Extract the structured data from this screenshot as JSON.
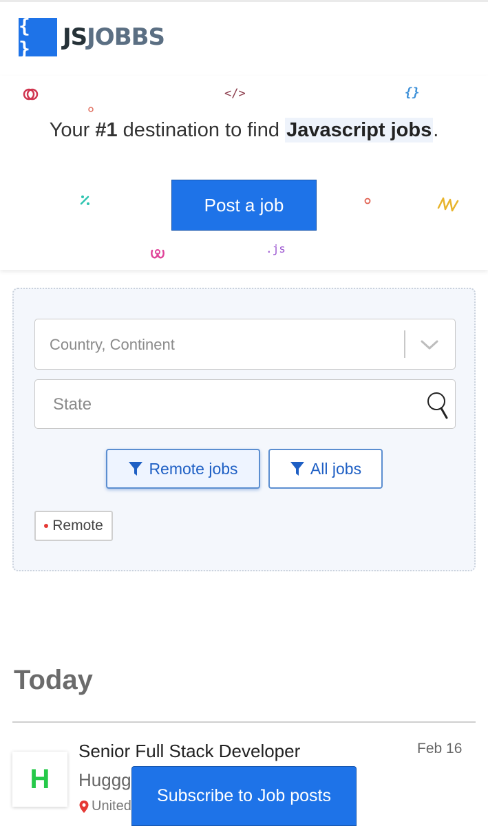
{
  "header": {
    "logo_mark": "{ }",
    "logo_js": "JS",
    "logo_jobbs": "JOBBS"
  },
  "hero": {
    "tagline_part1": "Your ",
    "tagline_rank": "#1",
    "tagline_part2": " destination to find ",
    "tagline_highlight": "Javascript jobs",
    "tagline_end": ".",
    "post_button": "Post a job",
    "decorations": {
      "code_tag": "</>",
      "braces": "{}",
      "js": ".js"
    }
  },
  "filters": {
    "country_placeholder": "Country, Continent",
    "state_placeholder": "State",
    "remote_button": "Remote jobs",
    "all_button": "All jobs",
    "active_tag": "Remote"
  },
  "listing": {
    "section_title": "Today",
    "jobs": [
      {
        "logo_letter": "H",
        "title": "Senior Full Stack Developer",
        "date": "Feb 16",
        "company": "Huggg",
        "location": "United"
      }
    ]
  },
  "subscribe_button": "Subscribe to Job posts",
  "colors": {
    "accent": "#1e73e8",
    "logo_green": "#26c94a",
    "tag_dot": "#e53935"
  }
}
